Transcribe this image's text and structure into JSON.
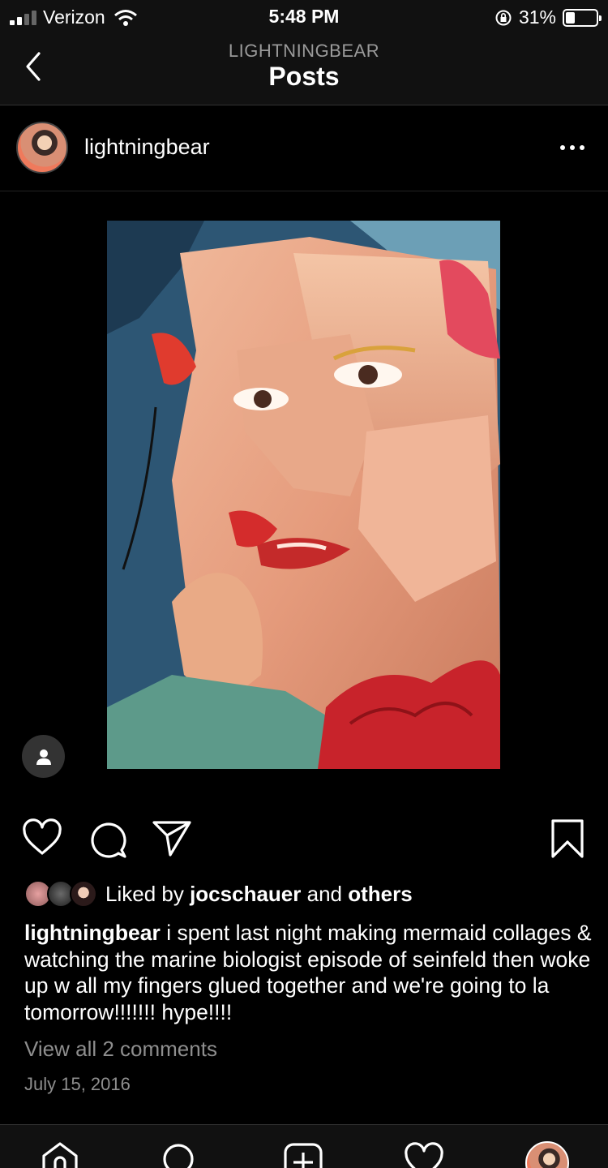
{
  "status_bar": {
    "carrier": "Verizon",
    "time": "5:48 PM",
    "battery_percent": "31%",
    "battery_level": 0.31,
    "icons": [
      "cellular-signal-icon",
      "wifi-icon",
      "orientation-lock-icon",
      "battery-icon"
    ]
  },
  "nav": {
    "subtitle": "LIGHTNINGBEAR",
    "title": "Posts",
    "back_icon": "chevron-left-icon"
  },
  "post": {
    "username": "lightningbear",
    "image_description": "collage",
    "likes": {
      "prefix": "Liked by",
      "user": "jocschauer",
      "connector": "and",
      "others": "others"
    },
    "caption": {
      "username": "lightningbear",
      "text": "i spent last night making mermaid collages & watching the marine biologist episode of seinfeld then woke up w all my fingers glued together and we're going to la tomorrow!!!!!!! hype!!!!"
    },
    "view_comments": "View all 2 comments",
    "date": "July 15, 2016"
  },
  "tabs": [
    "home",
    "search",
    "add",
    "activity",
    "profile"
  ],
  "colors": {
    "background": "#000000",
    "bars": "#111111",
    "muted_text": "#8e8e8e"
  }
}
